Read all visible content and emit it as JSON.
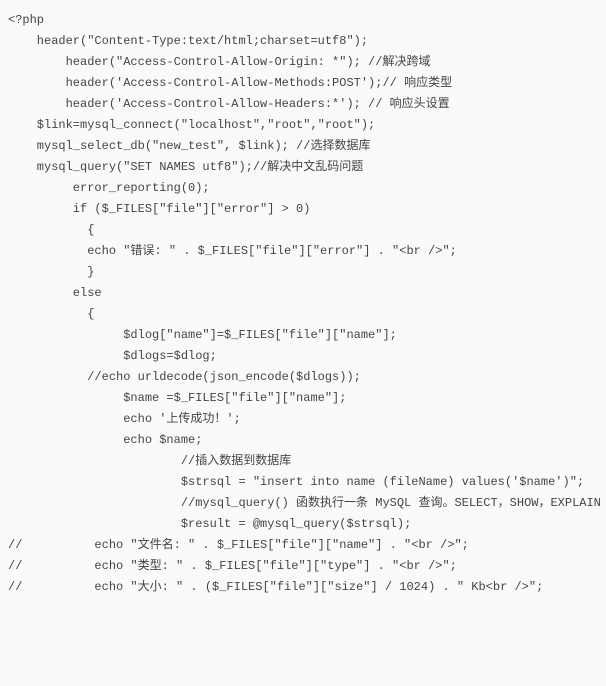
{
  "code_lines": [
    "<?php",
    "    header(\"Content-Type:text/html;charset=utf8\");",
    "        header(\"Access-Control-Allow-Origin: *\"); //解决跨域",
    "        header('Access-Control-Allow-Methods:POST');// 响应类型",
    "        header('Access-Control-Allow-Headers:*'); // 响应头设置",
    "    $link=mysql_connect(\"localhost\",\"root\",\"root\");",
    "    mysql_select_db(\"new_test\", $link); //选择数据库",
    "    mysql_query(\"SET NAMES utf8\");//解决中文乱码问题",
    "         error_reporting(0);",
    "         if ($_FILES[\"file\"][\"error\"] > 0)",
    "           {",
    "           echo \"错误: \" . $_FILES[\"file\"][\"error\"] . \"<br />\";",
    "           }",
    "         else",
    "           {",
    "                $dlog[\"name\"]=$_FILES[\"file\"][\"name\"];",
    "                $dlogs=$dlog;",
    "           //echo urldecode(json_encode($dlogs));",
    "                $name =$_FILES[\"file\"][\"name\"];",
    "                echo '上传成功！';",
    "                echo $name;",
    "                        //插入数据到数据库",
    "                        $strsql = \"insert into name (fileName) values('$name')\";",
    "                        //mysql_query() 函数执行一条 MySQL 查询。SELECT，SHOW，EXPLAIN",
    "                        $result = @mysql_query($strsql);",
    "//          echo \"文件名: \" . $_FILES[\"file\"][\"name\"] . \"<br />\";",
    "//          echo \"类型: \" . $_FILES[\"file\"][\"type\"] . \"<br />\";",
    "//          echo \"大小: \" . ($_FILES[\"file\"][\"size\"] / 1024) . \" Kb<br />\";"
  ]
}
